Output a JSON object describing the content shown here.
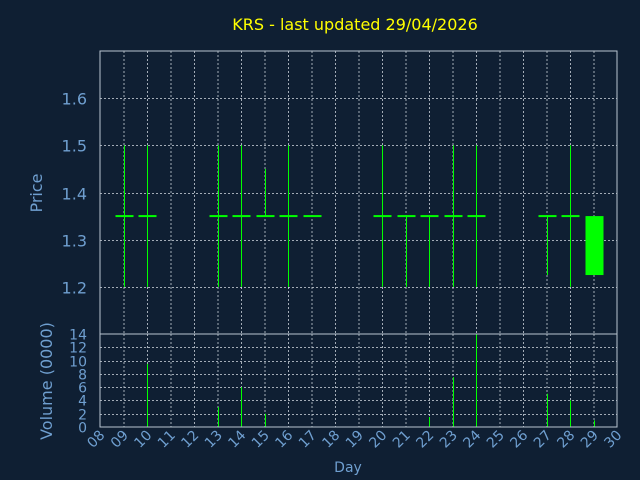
{
  "title": "KRS - last updated 29/04/2026",
  "colors": {
    "background": "#0f1f33",
    "title": "#ffff00",
    "axis_text": "#6f9fd0",
    "frame": "#b8c4d0",
    "grid": "#c8d0d8",
    "candle": "#00ff00"
  },
  "chart_data": [
    {
      "type": "candlestick",
      "panel": "price",
      "ylabel": "Price",
      "ylim": [
        1.1,
        1.7
      ],
      "yticks": [
        1.2,
        1.3,
        1.4,
        1.5,
        1.6
      ],
      "grid": true,
      "candles": [
        {
          "day": 9,
          "open": 1.35,
          "high": 1.5,
          "low": 1.2,
          "close": 1.35
        },
        {
          "day": 10,
          "open": 1.35,
          "high": 1.5,
          "low": 1.2,
          "close": 1.35
        },
        {
          "day": 13,
          "open": 1.35,
          "high": 1.5,
          "low": 1.2,
          "close": 1.35
        },
        {
          "day": 14,
          "open": 1.35,
          "high": 1.5,
          "low": 1.2,
          "close": 1.35
        },
        {
          "day": 15,
          "open": 1.35,
          "high": 1.45,
          "low": 1.35,
          "close": 1.35
        },
        {
          "day": 16,
          "open": 1.35,
          "high": 1.5,
          "low": 1.2,
          "close": 1.35
        },
        {
          "day": 17,
          "open": 1.35,
          "high": 1.35,
          "low": 1.35,
          "close": 1.35
        },
        {
          "day": 20,
          "open": 1.35,
          "high": 1.5,
          "low": 1.2,
          "close": 1.35
        },
        {
          "day": 21,
          "open": 1.35,
          "high": 1.35,
          "low": 1.2,
          "close": 1.35
        },
        {
          "day": 22,
          "open": 1.35,
          "high": 1.35,
          "low": 1.2,
          "close": 1.35
        },
        {
          "day": 23,
          "open": 1.35,
          "high": 1.5,
          "low": 1.2,
          "close": 1.35
        },
        {
          "day": 24,
          "open": 1.35,
          "high": 1.5,
          "low": 1.2,
          "close": 1.35
        },
        {
          "day": 27,
          "open": 1.35,
          "high": 1.35,
          "low": 1.225,
          "close": 1.35
        },
        {
          "day": 28,
          "open": 1.35,
          "high": 1.5,
          "low": 1.2,
          "close": 1.35
        },
        {
          "day": 29,
          "open": 1.35,
          "high": 1.35,
          "low": 1.225,
          "close": 1.225
        }
      ]
    },
    {
      "type": "bar",
      "panel": "volume",
      "ylabel": "Volume (0000)",
      "xlabel": "Day",
      "ylim": [
        0,
        14
      ],
      "yticks": [
        0,
        2,
        4,
        6,
        8,
        10,
        12,
        14
      ],
      "x_ticks": [
        "08",
        "09",
        "10",
        "11",
        "12",
        "13",
        "14",
        "15",
        "16",
        "17",
        "18",
        "19",
        "20",
        "21",
        "22",
        "23",
        "24",
        "25",
        "26",
        "27",
        "28",
        "29",
        "30"
      ],
      "grid": true,
      "bars": [
        {
          "day": 10,
          "volume": 9.5
        },
        {
          "day": 13,
          "volume": 3
        },
        {
          "day": 14,
          "volume": 6
        },
        {
          "day": 15,
          "volume": 2
        },
        {
          "day": 22,
          "volume": 1.5
        },
        {
          "day": 23,
          "volume": 7.5
        },
        {
          "day": 24,
          "volume": 14
        },
        {
          "day": 27,
          "volume": 5
        },
        {
          "day": 28,
          "volume": 4
        },
        {
          "day": 29,
          "volume": 1
        }
      ]
    }
  ]
}
